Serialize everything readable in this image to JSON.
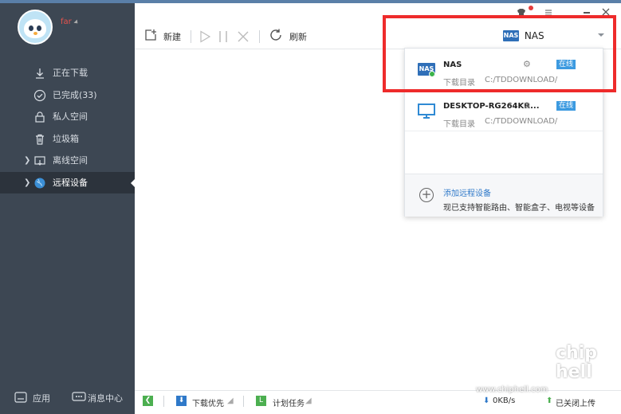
{
  "user": {
    "name": "far"
  },
  "nav": [
    {
      "label": "正在下载",
      "icon": "download-icon"
    },
    {
      "label": "已完成(33)",
      "icon": "check-circle-icon"
    },
    {
      "label": "私人空间",
      "icon": "lock-icon"
    },
    {
      "label": "垃圾箱",
      "icon": "trash-icon"
    },
    {
      "label": "离线空间",
      "icon": "cloud-space-icon"
    },
    {
      "label": "远程设备",
      "icon": "globe-icon"
    }
  ],
  "sidebar_footer": {
    "apps": "应用",
    "messages": "消息中心"
  },
  "toolbar": {
    "new_label": "新建",
    "refresh_label": "刷新"
  },
  "device_select": {
    "value": "NAS",
    "chip": "NAS"
  },
  "devices": [
    {
      "name": "NAS",
      "dir_label": "下载目录",
      "dir": "C:/TDDOWNLOAD/",
      "status": "在线",
      "chip": "NAS"
    },
    {
      "name": "DESKTOP-RG264KR...",
      "dir_label": "下载目录",
      "dir": "C:/TDDOWNLOAD/",
      "status": "在线"
    }
  ],
  "add_device": {
    "title": "添加远程设备",
    "subtitle": "现已支持智能路由、智能盒子、电视等设备"
  },
  "statusbar": {
    "priority": "下载优先",
    "schedule": "计划任务",
    "speed": "0KB/s",
    "upload": "已关闭上传"
  },
  "watermark": {
    "site": "www.chiphell.com",
    "logo": "chip hell"
  },
  "colors": {
    "sidebar": "#3d4753",
    "accent": "#2f79c9",
    "online": "#3c9ae0",
    "highlight": "#ee2b2b"
  }
}
